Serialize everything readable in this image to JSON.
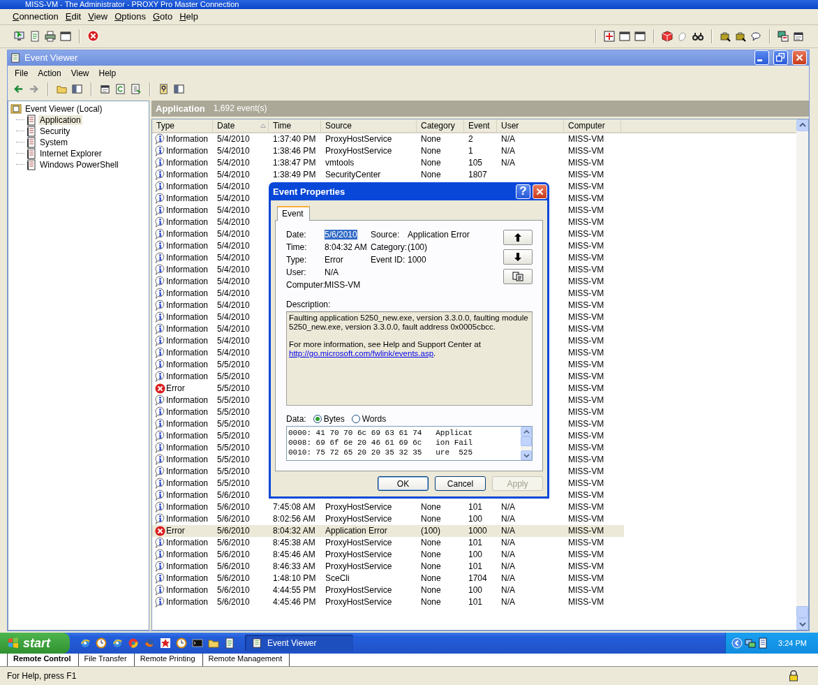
{
  "app_window": {
    "title": "MISS-VM - The Administrator - PROXY Pro Master Connection"
  },
  "menu": [
    {
      "label": "Connection"
    },
    {
      "label": "Edit"
    },
    {
      "label": "View"
    },
    {
      "label": "Options"
    },
    {
      "label": "Goto"
    },
    {
      "label": "Help"
    }
  ],
  "event_viewer": {
    "title": "Event Viewer",
    "menu": [
      {
        "label": "File"
      },
      {
        "label": "Action"
      },
      {
        "label": "View"
      },
      {
        "label": "Help"
      }
    ],
    "tree": {
      "label": "Event Viewer (Local)",
      "children": [
        {
          "label": "Application",
          "selected": true
        },
        {
          "label": "Security",
          "selected": false
        },
        {
          "label": "System",
          "selected": false
        },
        {
          "label": "Internet Explorer",
          "selected": false
        },
        {
          "label": "Windows PowerShell",
          "selected": false
        }
      ]
    },
    "list": {
      "title": "Application",
      "count": "1,692 event(s)",
      "columns": [
        {
          "label": "Type",
          "sorted": false
        },
        {
          "label": "Date",
          "sorted": true
        },
        {
          "label": "Time",
          "sorted": false
        },
        {
          "label": "Source",
          "sorted": false
        },
        {
          "label": "Category",
          "sorted": false
        },
        {
          "label": "Event",
          "sorted": false
        },
        {
          "label": "User",
          "sorted": false
        },
        {
          "label": "Computer",
          "sorted": false
        }
      ],
      "rows": [
        {
          "kind": "information",
          "type": "Information",
          "date": "5/4/2010",
          "time": "1:37:40 PM",
          "source": "ProxyHostService",
          "category": "None",
          "event": "2",
          "user": "N/A",
          "computer": "MISS-VM",
          "selected": false
        },
        {
          "kind": "information",
          "type": "Information",
          "date": "5/4/2010",
          "time": "1:38:46 PM",
          "source": "ProxyHostService",
          "category": "None",
          "event": "1",
          "user": "N/A",
          "computer": "MISS-VM",
          "selected": false
        },
        {
          "kind": "information",
          "type": "Information",
          "date": "5/4/2010",
          "time": "1:38:47 PM",
          "source": "vmtools",
          "category": "None",
          "event": "105",
          "user": "N/A",
          "computer": "MISS-VM",
          "selected": false
        },
        {
          "kind": "information",
          "type": "Information",
          "date": "5/4/2010",
          "time": "1:38:49 PM",
          "source": "SecurityCenter",
          "category": "None",
          "event": "1807",
          "computer": "MISS-VM",
          "selected": false
        },
        {
          "kind": "information",
          "type": "Information",
          "date": "5/4/2010",
          "computer": "MISS-VM",
          "selected": false
        },
        {
          "kind": "information",
          "type": "Information",
          "date": "5/4/2010",
          "computer": "MISS-VM",
          "selected": false
        },
        {
          "kind": "information",
          "type": "Information",
          "date": "5/4/2010",
          "computer": "MISS-VM",
          "selected": false
        },
        {
          "kind": "information",
          "type": "Information",
          "date": "5/4/2010",
          "computer": "MISS-VM",
          "selected": false
        },
        {
          "kind": "information",
          "type": "Information",
          "date": "5/4/2010",
          "computer": "MISS-VM",
          "selected": false
        },
        {
          "kind": "information",
          "type": "Information",
          "date": "5/4/2010",
          "computer": "MISS-VM",
          "selected": false
        },
        {
          "kind": "information",
          "type": "Information",
          "date": "5/4/2010",
          "computer": "MISS-VM",
          "selected": false
        },
        {
          "kind": "information",
          "type": "Information",
          "date": "5/4/2010",
          "computer": "MISS-VM",
          "selected": false
        },
        {
          "kind": "information",
          "type": "Information",
          "date": "5/4/2010",
          "computer": "MISS-VM",
          "selected": false
        },
        {
          "kind": "information",
          "type": "Information",
          "date": "5/4/2010",
          "computer": "MISS-VM",
          "selected": false
        },
        {
          "kind": "information",
          "type": "Information",
          "date": "5/4/2010",
          "computer": "MISS-VM",
          "selected": false
        },
        {
          "kind": "information",
          "type": "Information",
          "date": "5/4/2010",
          "computer": "MISS-VM",
          "selected": false
        },
        {
          "kind": "information",
          "type": "Information",
          "date": "5/4/2010",
          "computer": "MISS-VM",
          "selected": false
        },
        {
          "kind": "information",
          "type": "Information",
          "date": "5/4/2010",
          "computer": "MISS-VM",
          "selected": false
        },
        {
          "kind": "information",
          "type": "Information",
          "date": "5/4/2010",
          "computer": "MISS-VM",
          "selected": false
        },
        {
          "kind": "information",
          "type": "Information",
          "date": "5/5/2010",
          "computer": "MISS-VM",
          "selected": false
        },
        {
          "kind": "information",
          "type": "Information",
          "date": "5/5/2010",
          "computer": "MISS-VM",
          "selected": false
        },
        {
          "kind": "error",
          "type": "Error",
          "date": "5/5/2010",
          "computer": "MISS-VM",
          "selected": false
        },
        {
          "kind": "information",
          "type": "Information",
          "date": "5/5/2010",
          "computer": "MISS-VM",
          "selected": false
        },
        {
          "kind": "information",
          "type": "Information",
          "date": "5/5/2010",
          "computer": "MISS-VM",
          "selected": false
        },
        {
          "kind": "information",
          "type": "Information",
          "date": "5/5/2010",
          "computer": "MISS-VM",
          "selected": false
        },
        {
          "kind": "information",
          "type": "Information",
          "date": "5/5/2010",
          "computer": "MISS-VM",
          "selected": false
        },
        {
          "kind": "information",
          "type": "Information",
          "date": "5/5/2010",
          "computer": "MISS-VM",
          "selected": false
        },
        {
          "kind": "information",
          "type": "Information",
          "date": "5/5/2010",
          "computer": "MISS-VM",
          "selected": false
        },
        {
          "kind": "information",
          "type": "Information",
          "date": "5/5/2010",
          "computer": "MISS-VM",
          "selected": false
        },
        {
          "kind": "information",
          "type": "Information",
          "date": "5/5/2010",
          "computer": "MISS-VM",
          "selected": false
        },
        {
          "kind": "information",
          "type": "Information",
          "date": "5/6/2010",
          "computer": "MISS-VM",
          "selected": false
        },
        {
          "kind": "information",
          "type": "Information",
          "date": "5/6/2010",
          "time": "7:45:08 AM",
          "source": "ProxyHostService",
          "category": "None",
          "event": "101",
          "user": "N/A",
          "computer": "MISS-VM",
          "selected": false
        },
        {
          "kind": "information",
          "type": "Information",
          "date": "5/6/2010",
          "time": "8:02:56 AM",
          "source": "ProxyHostService",
          "category": "None",
          "event": "100",
          "user": "N/A",
          "computer": "MISS-VM",
          "selected": false
        },
        {
          "kind": "error",
          "type": "Error",
          "date": "5/6/2010",
          "time": "8:04:32 AM",
          "source": "Application Error",
          "category": "(100)",
          "event": "1000",
          "user": "N/A",
          "computer": "MISS-VM",
          "selected": true
        },
        {
          "kind": "information",
          "type": "Information",
          "date": "5/6/2010",
          "time": "8:45:38 AM",
          "source": "ProxyHostService",
          "category": "None",
          "event": "101",
          "user": "N/A",
          "computer": "MISS-VM",
          "selected": false
        },
        {
          "kind": "information",
          "type": "Information",
          "date": "5/6/2010",
          "time": "8:45:46 AM",
          "source": "ProxyHostService",
          "category": "None",
          "event": "100",
          "user": "N/A",
          "computer": "MISS-VM",
          "selected": false
        },
        {
          "kind": "information",
          "type": "Information",
          "date": "5/6/2010",
          "time": "8:46:33 AM",
          "source": "ProxyHostService",
          "category": "None",
          "event": "101",
          "user": "N/A",
          "computer": "MISS-VM",
          "selected": false
        },
        {
          "kind": "information",
          "type": "Information",
          "date": "5/6/2010",
          "time": "1:48:10 PM",
          "source": "SceCli",
          "category": "None",
          "event": "1704",
          "user": "N/A",
          "computer": "MISS-VM",
          "selected": false
        },
        {
          "kind": "information",
          "type": "Information",
          "date": "5/6/2010",
          "time": "4:44:55 PM",
          "source": "ProxyHostService",
          "category": "None",
          "event": "100",
          "user": "N/A",
          "computer": "MISS-VM",
          "selected": false
        },
        {
          "kind": "information",
          "type": "Information",
          "date": "5/6/2010",
          "time": "4:45:46 PM",
          "source": "ProxyHostService",
          "category": "None",
          "event": "101",
          "user": "N/A",
          "computer": "MISS-VM",
          "selected": false
        }
      ]
    }
  },
  "dialog": {
    "title": "Event Properties",
    "help": "?",
    "tabs": [
      {
        "label": "Event",
        "selected": true
      }
    ],
    "left_fields": [
      {
        "label": "Date:",
        "value": "5/6/2010",
        "selected": true
      },
      {
        "label": "Time:",
        "value": "8:04:32 AM",
        "selected": false
      },
      {
        "label": "Type:",
        "value": "Error",
        "selected": false
      },
      {
        "label": "User:",
        "value": "N/A",
        "selected": false
      },
      {
        "label": "Computer:",
        "value": "MISS-VM",
        "selected": false
      }
    ],
    "right_fields": [
      {
        "label": "Source:",
        "value": "Application Error"
      },
      {
        "label": "Category:",
        "value": "(100)"
      },
      {
        "label": "Event ID:",
        "value": "1000"
      }
    ],
    "description_label": "Description:",
    "description": "Faulting application 5250_new.exe, version 3.3.0.0, faulting module 5250_new.exe, version 3.3.0.0, fault address 0x0005cbcc.",
    "more_info": "For more information, see Help and Support Center at",
    "link": "http://go.microsoft.com/fwlink/events.asp",
    "link_after": ".",
    "data_label": "Data:",
    "formats": [
      {
        "label": "Bytes",
        "selected": true
      },
      {
        "label": "Words",
        "selected": false
      }
    ],
    "data_lines": [
      "0000: 41 70 70 6c 69 63 61 74   Applicat",
      "0008: 69 6f 6e 20 46 61 69 6c   ion Fail",
      "0010: 75 72 65 20 20 35 32 35   ure  525"
    ],
    "buttons": [
      {
        "label": "OK",
        "default": true,
        "disabled": false
      },
      {
        "label": "Cancel",
        "default": false,
        "disabled": false
      },
      {
        "label": "Apply",
        "default": false,
        "disabled": true
      }
    ]
  },
  "taskbar": {
    "start": "start",
    "tasks": [
      {
        "label": "Event Viewer",
        "selected": true
      }
    ],
    "clock": "3:24 PM"
  },
  "tabs": [
    {
      "label": "Remote Control",
      "selected": true
    },
    {
      "label": "File Transfer",
      "selected": false
    },
    {
      "label": "Remote Printing",
      "selected": false
    },
    {
      "label": "Remote Management",
      "selected": false
    }
  ],
  "status": "For Help, press F1"
}
